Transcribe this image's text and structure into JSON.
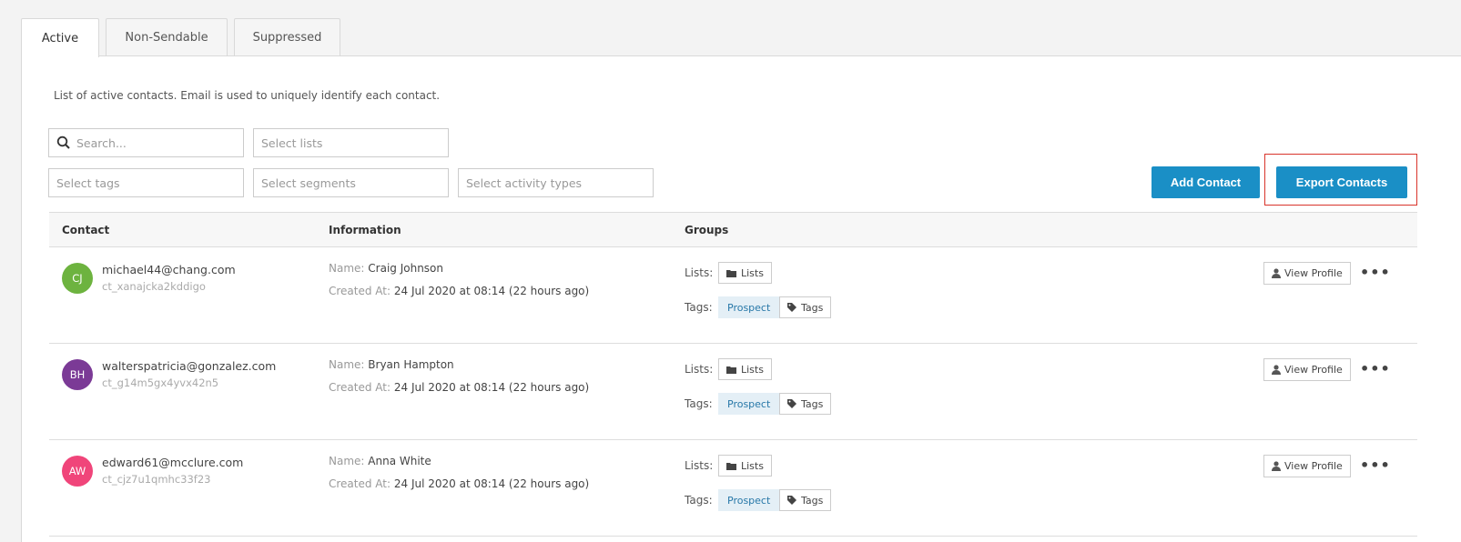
{
  "tabs": [
    {
      "label": "Active",
      "active": true
    },
    {
      "label": "Non-Sendable",
      "active": false
    },
    {
      "label": "Suppressed",
      "active": false
    }
  ],
  "description": "List of active contacts. Email is used to uniquely identify each contact.",
  "filters": {
    "search_placeholder": "Search...",
    "lists_placeholder": "Select lists",
    "tags_placeholder": "Select tags",
    "segments_placeholder": "Select segments",
    "activity_placeholder": "Select activity types"
  },
  "actions": {
    "add_contact": "Add Contact",
    "export_contacts": "Export Contacts"
  },
  "table": {
    "headers": {
      "contact": "Contact",
      "information": "Information",
      "groups": "Groups"
    },
    "labels": {
      "name": "Name:",
      "created_at": "Created At:",
      "lists": "Lists:",
      "tags": "Tags:"
    },
    "buttons": {
      "lists": "Lists",
      "tags": "Tags",
      "view_profile": "View Profile",
      "more": "•••"
    },
    "rows": [
      {
        "initials": "CJ",
        "avatar_color": "#6db33f",
        "email": "michael44@chang.com",
        "contact_id": "ct_xanajcka2kddigo",
        "name": "Craig Johnson",
        "created_at": "24 Jul 2020 at 08:14 (22 hours ago)",
        "tag": "Prospect"
      },
      {
        "initials": "BH",
        "avatar_color": "#7b3a96",
        "email": "walterspatricia@gonzalez.com",
        "contact_id": "ct_g14m5gx4yvx42n5",
        "name": "Bryan Hampton",
        "created_at": "24 Jul 2020 at 08:14 (22 hours ago)",
        "tag": "Prospect"
      },
      {
        "initials": "AW",
        "avatar_color": "#f0457a",
        "email": "edward61@mcclure.com",
        "contact_id": "ct_cjz7u1qmhc33f23",
        "name": "Anna White",
        "created_at": "24 Jul 2020 at 08:14 (22 hours ago)",
        "tag": "Prospect"
      }
    ]
  },
  "colors": {
    "primary": "#1a8fc6",
    "highlight": "#d9342b",
    "badge_bg": "#e4eff6"
  }
}
